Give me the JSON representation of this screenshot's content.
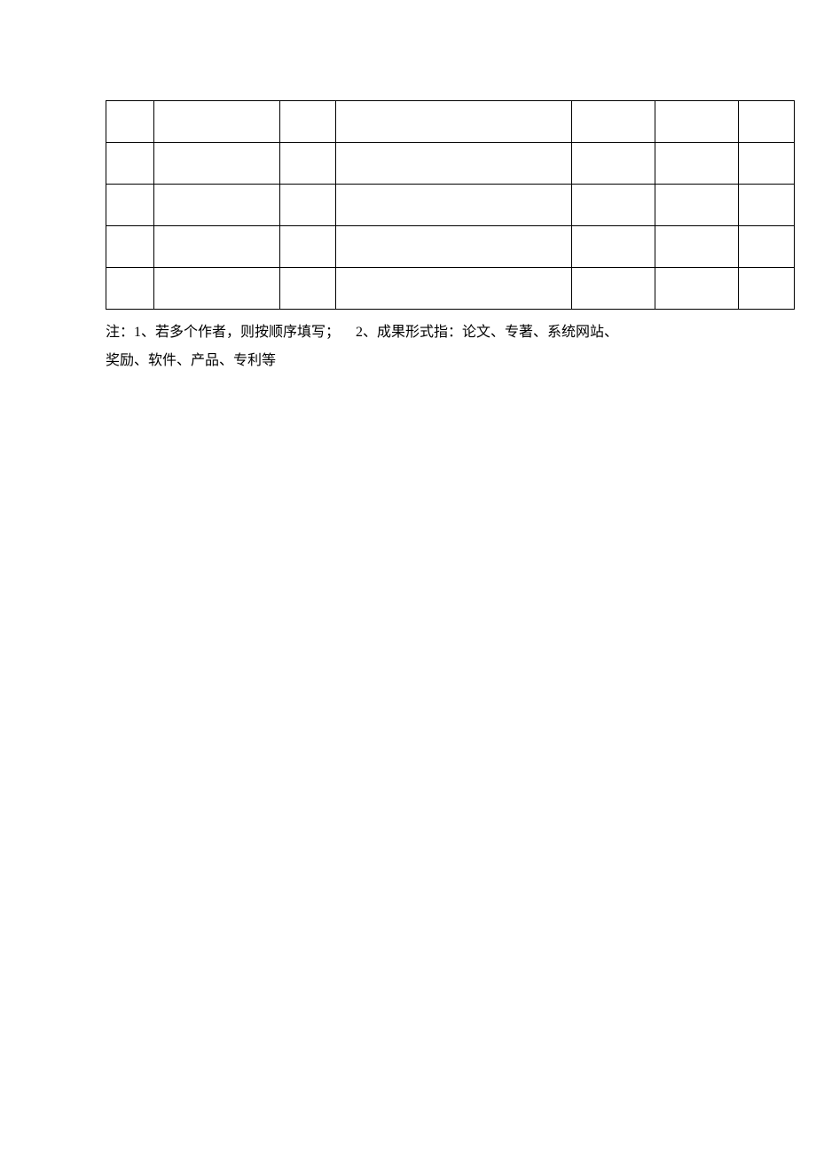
{
  "table": {
    "rows": [
      [
        "",
        "",
        "",
        "",
        "",
        "",
        ""
      ],
      [
        "",
        "",
        "",
        "",
        "",
        "",
        ""
      ],
      [
        "",
        "",
        "",
        "",
        "",
        "",
        ""
      ],
      [
        "",
        "",
        "",
        "",
        "",
        "",
        ""
      ],
      [
        "",
        "",
        "",
        "",
        "",
        "",
        ""
      ]
    ]
  },
  "note": {
    "prefix": "注：",
    "item1_num": "1",
    "item1_text": "、若多个作者，则按顺序填写；",
    "item2_num": "2",
    "item2_text": "、成果形式指：论文、专著、系统网站、",
    "line2": "奖励、软件、产品、专利等"
  }
}
